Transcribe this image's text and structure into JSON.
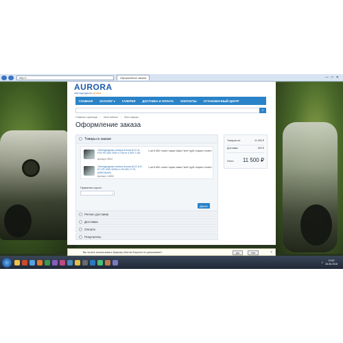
{
  "browser": {
    "address": "http://...",
    "tab_title": "Оформление заказа"
  },
  "site": {
    "logo": "AURORA",
    "tagline_a": "светодиодная",
    "tagline_b": "оптика",
    "nav": [
      "ГЛАВНАЯ",
      "КАТАЛОГ ▾",
      "ГАЛЕРЕЯ",
      "ДОСТАВКА И ОПЛАТА",
      "КОНТАКТЫ",
      "УСТАНОВОЧНЫЙ ЦЕНТР"
    ],
    "breadcrumbs": [
      "Главная страница",
      "Моё избное",
      "Мои заказы"
    ]
  },
  "page_title": "Оформление заказа",
  "order": {
    "section_title": "Товары в заказе",
    "items": [
      {
        "name": "Светодиодная оптика Aurora ALO-A-P1E 9V-36V 20W 1720Lm 9-36V 1.5A",
        "article_label": "Артикул:",
        "article": "5902",
        "qty": "1 шт",
        "price": "5 000 <nobr><span class=\"text\">руб.</span></nobr>"
      },
      {
        "name": "Светодиодная оптика Aurora ALO-A-E-8T-HR 40W 3000Lm 9V-36V 3.7A (ВРЕЗНАЯ)",
        "article_label": "Артикул:",
        "article": "14652",
        "qty": "1 шт",
        "price": "6 500 <nobr><span class=\"text\">руб.</span></nobr>"
      }
    ],
    "coupon_label": "Применить купон:",
    "next_button": "Далее",
    "steps": [
      "Регион доставки",
      "Доставка",
      "Оплата",
      "Покупатель"
    ]
  },
  "summary": {
    "goods_label": "Товаров на:",
    "goods_value": "11 500 ₽",
    "delivery_label": "Доставка:",
    "delivery_value": "500 ₽",
    "total_label": "Итого:",
    "total_value": "11 500 ₽"
  },
  "notification": {
    "text": "Вы хотите использовать браузер Internet Explorer по умолчанию?",
    "yes": "Да",
    "no": "Нет"
  },
  "taskbar": {
    "time": "13:52",
    "date": "26.06.2016"
  },
  "colors": {
    "accent": "#2a83c8",
    "link": "#2a6cb3"
  }
}
